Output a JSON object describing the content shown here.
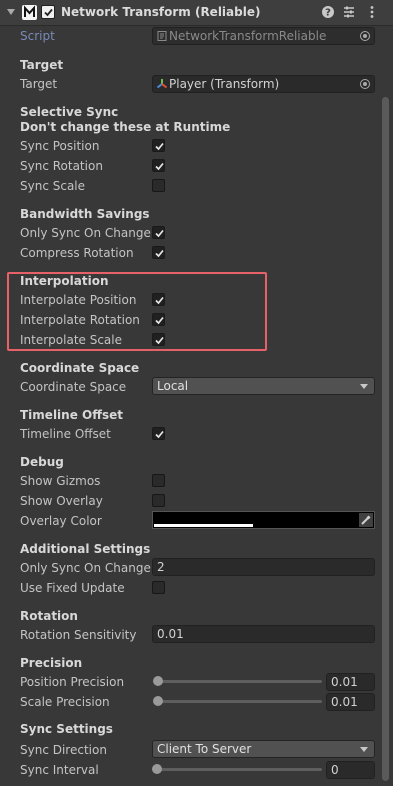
{
  "header": {
    "title": "Network Transform (Reliable)",
    "enabled": true,
    "icons": [
      "foldout-arrow-icon",
      "mirror-logo-icon",
      "help-icon",
      "preset-icon",
      "menu-kebab-icon"
    ]
  },
  "script": {
    "label": "Script",
    "value": "NetworkTransformReliable"
  },
  "target_section": {
    "header": "Target",
    "label": "Target",
    "value": "Player (Transform)"
  },
  "selective_sync": {
    "header": "Selective Sync",
    "note": "Don't change these at Runtime",
    "items": [
      {
        "label": "Sync Position",
        "checked": true
      },
      {
        "label": "Sync Rotation",
        "checked": true
      },
      {
        "label": "Sync Scale",
        "checked": false
      }
    ]
  },
  "bandwidth": {
    "header": "Bandwidth Savings",
    "items": [
      {
        "label": "Only Sync On Change",
        "checked": true
      },
      {
        "label": "Compress Rotation",
        "checked": true
      }
    ]
  },
  "interpolation": {
    "header": "Interpolation",
    "items": [
      {
        "label": "Interpolate Position",
        "checked": true
      },
      {
        "label": "Interpolate Rotation",
        "checked": true
      },
      {
        "label": "Interpolate Scale",
        "checked": true
      }
    ],
    "highlight_color": "#e86068"
  },
  "coordinate": {
    "header": "Coordinate Space",
    "label": "Coordinate Space",
    "value": "Local"
  },
  "timeline": {
    "header": "Timeline Offset",
    "label": "Timeline Offset",
    "checked": true
  },
  "debug": {
    "header": "Debug",
    "show_gizmos": {
      "label": "Show Gizmos",
      "checked": false
    },
    "show_overlay": {
      "label": "Show Overlay",
      "checked": false
    },
    "overlay_color": {
      "label": "Overlay Color",
      "color": "#000000",
      "alpha": 0.45
    }
  },
  "additional": {
    "header": "Additional Settings",
    "only_sync_threshold": {
      "label": "Only Sync On Change C",
      "value": "2"
    },
    "use_fixed_update": {
      "label": "Use Fixed Update",
      "checked": false
    }
  },
  "rotation": {
    "header": "Rotation",
    "label": "Rotation Sensitivity",
    "value": "0.01"
  },
  "precision": {
    "header": "Precision",
    "position": {
      "label": "Position Precision",
      "value": "0.01",
      "fraction": 0.0
    },
    "scale": {
      "label": "Scale Precision",
      "value": "0.01",
      "fraction": 0.0
    }
  },
  "sync_settings": {
    "header": "Sync Settings",
    "direction": {
      "label": "Sync Direction",
      "value": "Client To Server"
    },
    "interval": {
      "label": "Sync Interval",
      "value": "0",
      "fraction": 0.0
    }
  }
}
